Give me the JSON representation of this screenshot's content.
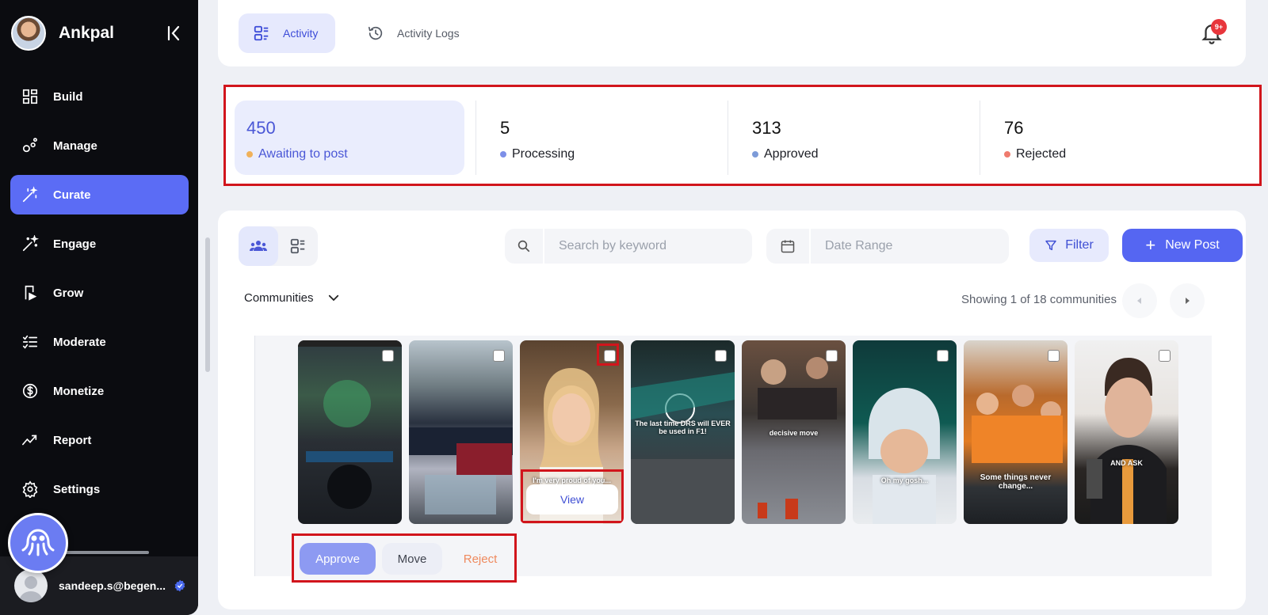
{
  "sidebar": {
    "brand": "Ankpal",
    "items": [
      {
        "label": "Build"
      },
      {
        "label": "Manage"
      },
      {
        "label": "Curate"
      },
      {
        "label": "Engage"
      },
      {
        "label": "Grow"
      },
      {
        "label": "Moderate"
      },
      {
        "label": "Monetize"
      },
      {
        "label": "Report"
      },
      {
        "label": "Settings"
      }
    ],
    "active_item": "Curate",
    "user_email": "sandeep.s@begen..."
  },
  "header": {
    "tabs": [
      {
        "label": "Activity",
        "active": true
      },
      {
        "label": "Activity Logs",
        "active": false
      }
    ],
    "notifications_badge": "9+"
  },
  "stats": [
    {
      "value": "450",
      "label": "Awaiting to post",
      "dot_color": "#f0b15a",
      "active": true
    },
    {
      "value": "5",
      "label": "Processing",
      "dot_color": "#7d8fe8",
      "active": false
    },
    {
      "value": "313",
      "label": "Approved",
      "dot_color": "#7d9bd8",
      "active": false
    },
    {
      "value": "76",
      "label": "Rejected",
      "dot_color": "#ef7b6e",
      "active": false
    }
  ],
  "toolbar": {
    "search_placeholder": "Search by keyword",
    "date_placeholder": "Date Range",
    "filter_label": "Filter",
    "new_post_label": "New Post"
  },
  "communities": {
    "select_label": "Communities",
    "showing_text": "Showing 1 of 18 communities"
  },
  "gallery": {
    "thumbnails": [
      {
        "caption": "",
        "selected": false
      },
      {
        "caption": "",
        "selected": false
      },
      {
        "caption": "I'm very proud of you...",
        "selected": false,
        "hovered": true
      },
      {
        "caption": "The last time DRS will EVER be used in F1!",
        "selected": false
      },
      {
        "caption": "decisive move",
        "selected": false
      },
      {
        "caption": "Oh my gosh...",
        "selected": false
      },
      {
        "caption": "Some things never change...",
        "selected": false
      },
      {
        "caption": "AND ASK",
        "selected": false
      }
    ],
    "view_label": "View"
  },
  "actions": {
    "approve": "Approve",
    "move": "Move",
    "reject": "Reject"
  },
  "colors": {
    "accent": "#5566f2",
    "sidebar_bg": "#0b0c10",
    "highlight": "#d1151c"
  }
}
